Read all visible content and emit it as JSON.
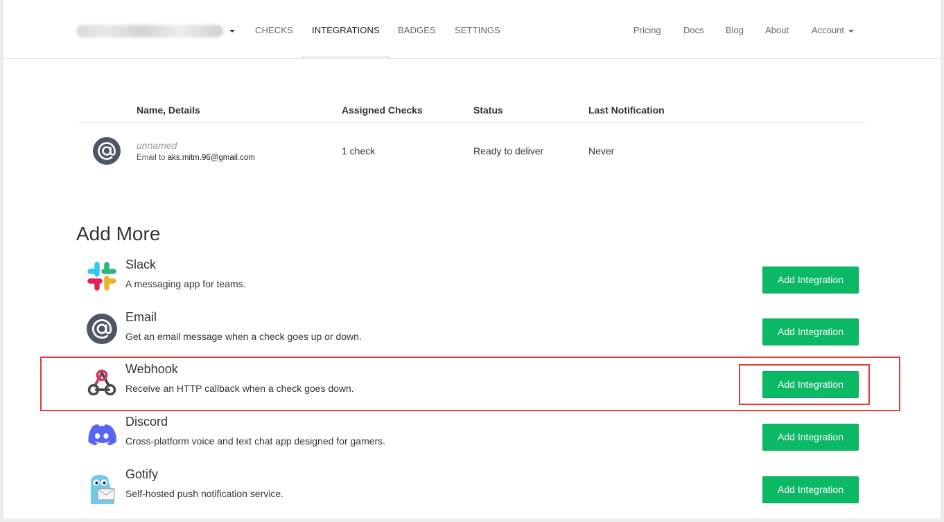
{
  "nav": {
    "brand_label": "",
    "links": [
      "CHECKS",
      "INTEGRATIONS",
      "BADGES",
      "SETTINGS"
    ],
    "active": "INTEGRATIONS",
    "right_links": [
      "Pricing",
      "Docs",
      "Blog",
      "About",
      "Account"
    ]
  },
  "table": {
    "headers": {
      "name": "Name, Details",
      "assigned": "Assigned Checks",
      "status": "Status",
      "last": "Last Notification"
    },
    "rows": [
      {
        "icon": "at-sign-icon",
        "name": "unnamed",
        "detail_prefix": "Email to",
        "detail_value": "aks.mitm.96@gmail.com",
        "assigned": "1 check",
        "status": "Ready to deliver",
        "last": "Never"
      }
    ]
  },
  "add_more": {
    "title": "Add More",
    "button_label": "Add Integration",
    "items": [
      {
        "name": "Slack",
        "desc": "A messaging app for teams.",
        "icon": "slack-icon"
      },
      {
        "name": "Email",
        "desc": "Get an email message when a check goes up or down.",
        "icon": "at-sign-icon"
      },
      {
        "name": "Webhook",
        "desc": "Receive an HTTP callback when a check goes down.",
        "icon": "webhook-icon"
      },
      {
        "name": "Discord",
        "desc": "Cross-platform voice and text chat app designed for gamers.",
        "icon": "discord-icon"
      },
      {
        "name": "Gotify",
        "desc": "Self-hosted push notification service.",
        "icon": "gotify-icon"
      }
    ]
  },
  "colors": {
    "primary_button": "#0bb863",
    "highlight": "#e53935",
    "icon_gray": "#4d5664",
    "discord": "#5865f2"
  }
}
